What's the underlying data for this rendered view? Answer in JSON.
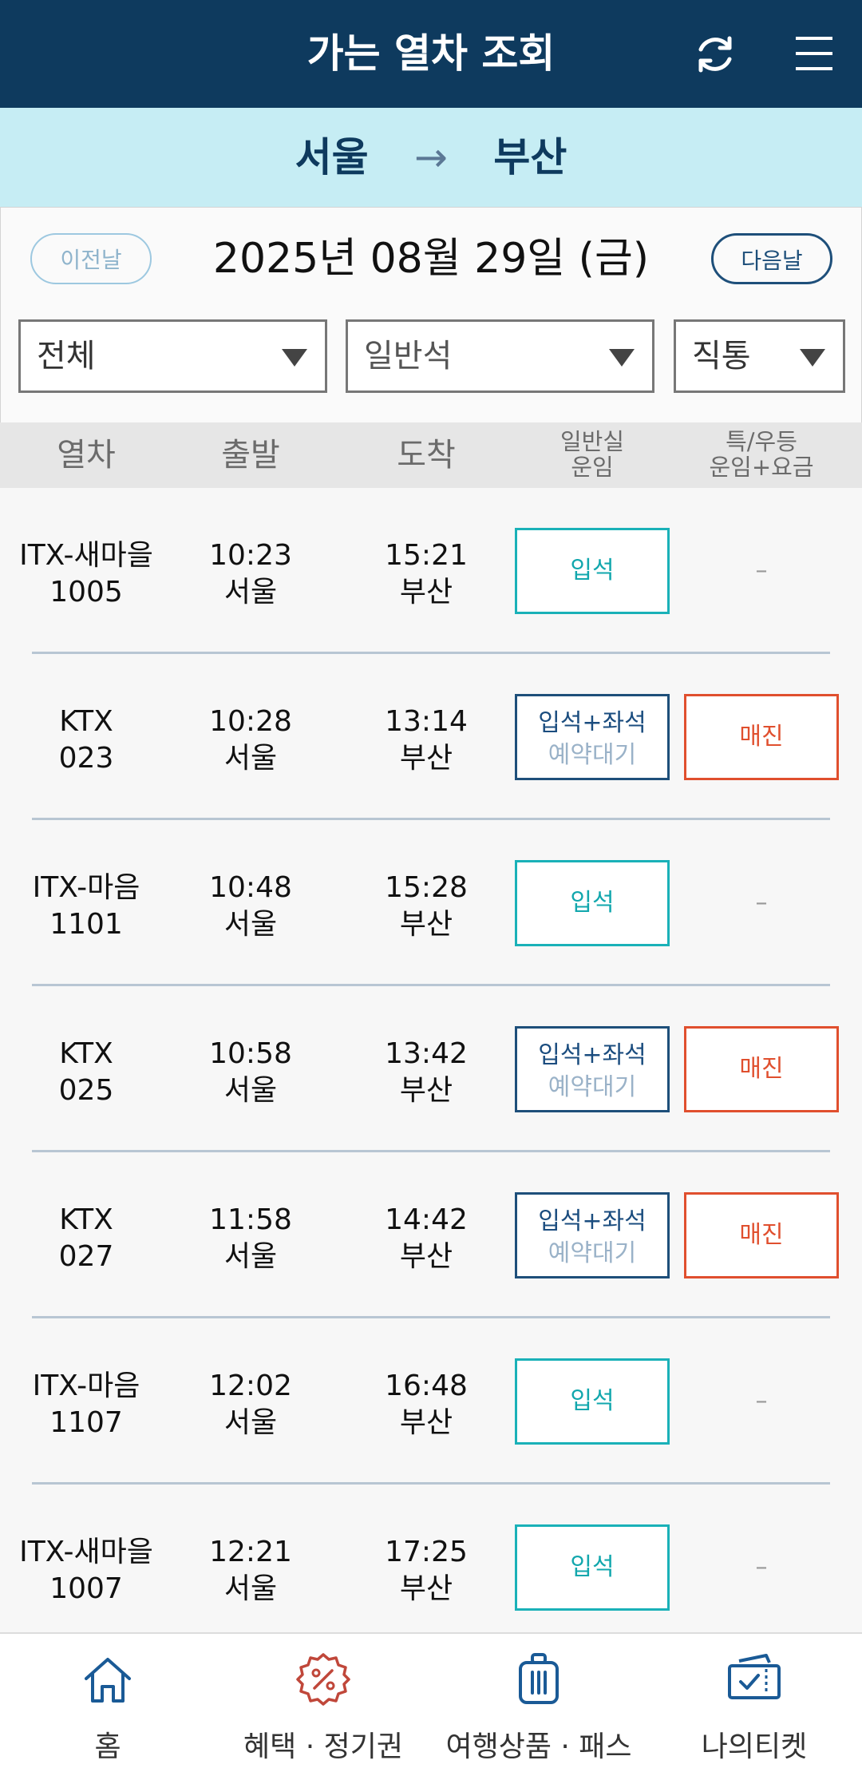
{
  "header": {
    "title": "가는 열차 조회",
    "refresh_icon": "refresh-icon",
    "menu_icon": "hamburger-menu-icon"
  },
  "route": {
    "from": "서울",
    "arrow": "→",
    "to": "부산"
  },
  "date_nav": {
    "prev_label": "이전날",
    "date": "2025년 08월 29일 (금)",
    "next_label": "다음날"
  },
  "filters": {
    "train_type": "전체",
    "seat_class": "일반석",
    "route_type": "직통"
  },
  "columns": {
    "train": "열차",
    "departure": "출발",
    "arrival": "도착",
    "standard_fare_1": "일반실",
    "standard_fare_2": "운임",
    "special_fare_1": "특/우등",
    "special_fare_2": "운임+요금"
  },
  "trains": [
    {
      "name": "ITX-새마을",
      "number": "1005",
      "dep_time": "10:23",
      "dep_station": "서울",
      "arr_time": "15:21",
      "arr_station": "부산",
      "seat_kind": "standing",
      "seat_line1": "입석",
      "seat_line2": "",
      "special_kind": "dash",
      "special": "–"
    },
    {
      "name": "KTX",
      "number": "023",
      "dep_time": "10:28",
      "dep_station": "서울",
      "arr_time": "13:14",
      "arr_station": "부산",
      "seat_kind": "combo",
      "seat_line1": "입석+좌석",
      "seat_line2": "예약대기",
      "special_kind": "sold",
      "special": "매진"
    },
    {
      "name": "ITX-마음",
      "number": "1101",
      "dep_time": "10:48",
      "dep_station": "서울",
      "arr_time": "15:28",
      "arr_station": "부산",
      "seat_kind": "standing",
      "seat_line1": "입석",
      "seat_line2": "",
      "special_kind": "dash",
      "special": "–"
    },
    {
      "name": "KTX",
      "number": "025",
      "dep_time": "10:58",
      "dep_station": "서울",
      "arr_time": "13:42",
      "arr_station": "부산",
      "seat_kind": "combo",
      "seat_line1": "입석+좌석",
      "seat_line2": "예약대기",
      "special_kind": "sold",
      "special": "매진"
    },
    {
      "name": "KTX",
      "number": "027",
      "dep_time": "11:58",
      "dep_station": "서울",
      "arr_time": "14:42",
      "arr_station": "부산",
      "seat_kind": "combo",
      "seat_line1": "입석+좌석",
      "seat_line2": "예약대기",
      "special_kind": "sold",
      "special": "매진"
    },
    {
      "name": "ITX-마음",
      "number": "1107",
      "dep_time": "12:02",
      "dep_station": "서울",
      "arr_time": "16:48",
      "arr_station": "부산",
      "seat_kind": "standing",
      "seat_line1": "입석",
      "seat_line2": "",
      "special_kind": "dash",
      "special": "–"
    },
    {
      "name": "ITX-새마을",
      "number": "1007",
      "dep_time": "12:21",
      "dep_station": "서울",
      "arr_time": "17:25",
      "arr_station": "부산",
      "seat_kind": "standing",
      "seat_line1": "입석",
      "seat_line2": "",
      "special_kind": "dash",
      "special": "–"
    }
  ],
  "tabbar": [
    {
      "label": "홈",
      "icon": "home-icon"
    },
    {
      "label": "혜택 · 정기권",
      "icon": "discount-badge-icon"
    },
    {
      "label": "여행상품 · 패스",
      "icon": "luggage-icon"
    },
    {
      "label": "나의티켓",
      "icon": "ticket-check-icon"
    }
  ],
  "colors": {
    "header_bg": "#0e3a5e",
    "route_bg": "#c6edf4",
    "standing": "#1ab1b8",
    "sold_out": "#e04f2e",
    "accent": "#1e4f7a"
  }
}
